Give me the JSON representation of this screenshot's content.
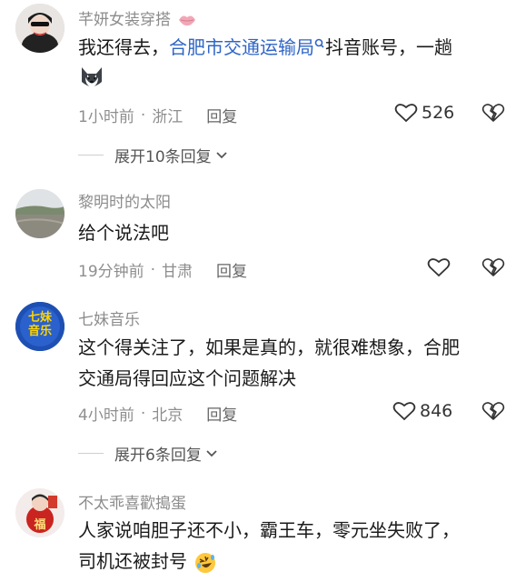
{
  "comments": [
    {
      "username": "芊妍女装穿搭",
      "username_icon": "lips-icon",
      "text_line1_a": "我还得去，",
      "text_link": "合肥市交通运输局",
      "text_line1_b": "抖音账号，一趟",
      "text_line2_emoji": "husky-dog-emoji",
      "time": "1小时前",
      "location": "浙江",
      "reply": "回复",
      "likes": "526",
      "expand": "展开10条回复"
    },
    {
      "username": "黎明时的太阳",
      "text_line1": "给个说法吧",
      "time": "19分钟前",
      "location": "甘肃",
      "reply": "回复"
    },
    {
      "username": "七妹音乐",
      "avatar_text_1": "七妹",
      "avatar_text_2": "音乐",
      "text_line1": "这个得关注了，如果是真的，就很难想象，合肥",
      "text_line2": "交通局得回应这个问题解决",
      "time": "4小时前",
      "location": "北京",
      "reply": "回复",
      "likes": "846",
      "expand": "展开6条回复"
    },
    {
      "username": "不太乖喜歡搗蛋",
      "avatar_text": "福",
      "text_line1": "人家说咱胆子还不小，霸王车，零元坐失败了，",
      "text_line2": "司机还被封号",
      "text_line2_emoji": "rolling-laughing-emoji"
    }
  ],
  "separator": "·",
  "colors": {
    "link": "#2f65c6",
    "meta": "#8e8e8e",
    "text": "#1a1a1a"
  }
}
